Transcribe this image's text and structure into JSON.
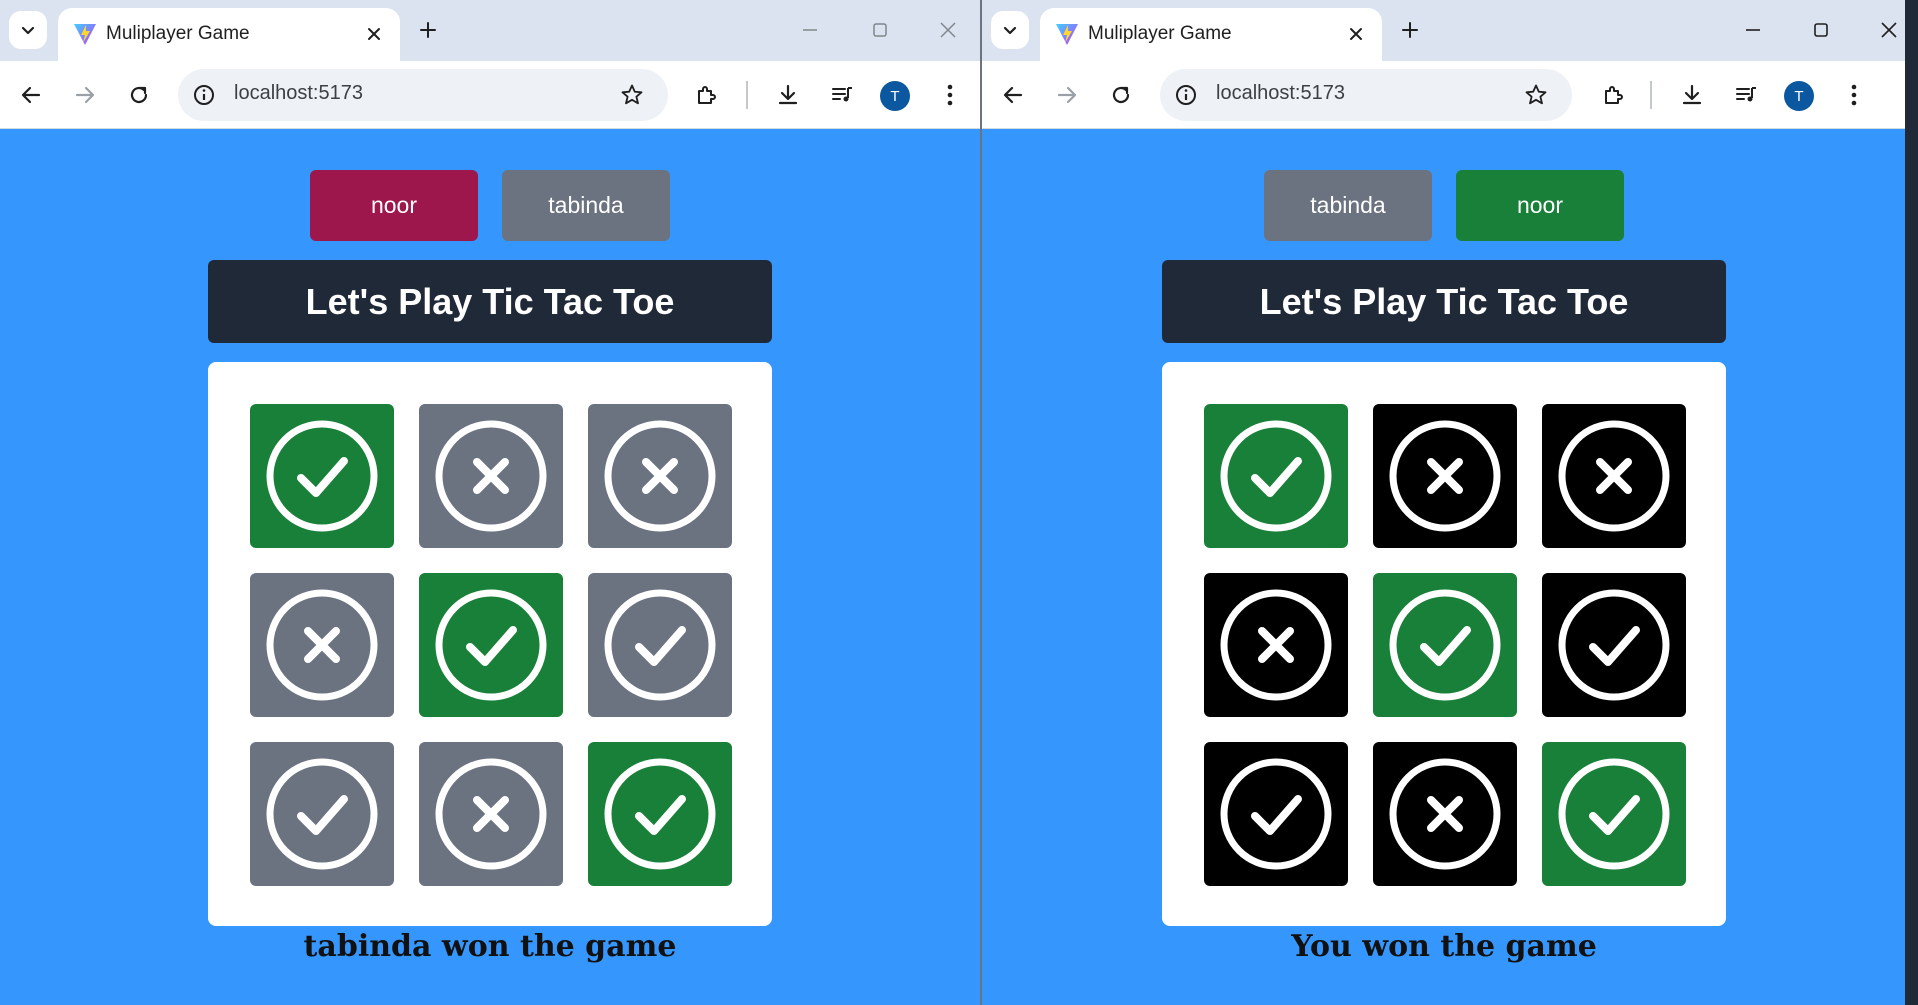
{
  "colors": {
    "page_background": "#3597fd",
    "win_green": "#188038",
    "gray": "#6b7280",
    "black": "#000000",
    "crimson": "#9d174d",
    "banner": "#1f2937"
  },
  "windows": [
    {
      "tab_title": "Muliplayer Game",
      "url": "localhost:5173",
      "profile_initial": "T",
      "players": [
        {
          "name": "noor",
          "color": "#9d174d"
        },
        {
          "name": "tabinda",
          "color": "#6b7280"
        }
      ],
      "heading": "Let's Play Tic Tac Toe",
      "board": [
        {
          "mark": "check",
          "color": "#188038"
        },
        {
          "mark": "x",
          "color": "#6b7280"
        },
        {
          "mark": "x",
          "color": "#6b7280"
        },
        {
          "mark": "x",
          "color": "#6b7280"
        },
        {
          "mark": "check",
          "color": "#188038"
        },
        {
          "mark": "check",
          "color": "#6b7280"
        },
        {
          "mark": "check",
          "color": "#6b7280"
        },
        {
          "mark": "x",
          "color": "#6b7280"
        },
        {
          "mark": "check",
          "color": "#188038"
        }
      ],
      "result": "tabinda won the game"
    },
    {
      "tab_title": "Muliplayer Game",
      "url": "localhost:5173",
      "profile_initial": "T",
      "players": [
        {
          "name": "tabinda",
          "color": "#6b7280"
        },
        {
          "name": "noor",
          "color": "#188038"
        }
      ],
      "heading": "Let's Play Tic Tac Toe",
      "board": [
        {
          "mark": "check",
          "color": "#188038"
        },
        {
          "mark": "x",
          "color": "#000000"
        },
        {
          "mark": "x",
          "color": "#000000"
        },
        {
          "mark": "x",
          "color": "#000000"
        },
        {
          "mark": "check",
          "color": "#188038"
        },
        {
          "mark": "check",
          "color": "#000000"
        },
        {
          "mark": "check",
          "color": "#000000"
        },
        {
          "mark": "x",
          "color": "#000000"
        },
        {
          "mark": "check",
          "color": "#188038"
        }
      ],
      "result": "You won the game"
    }
  ]
}
